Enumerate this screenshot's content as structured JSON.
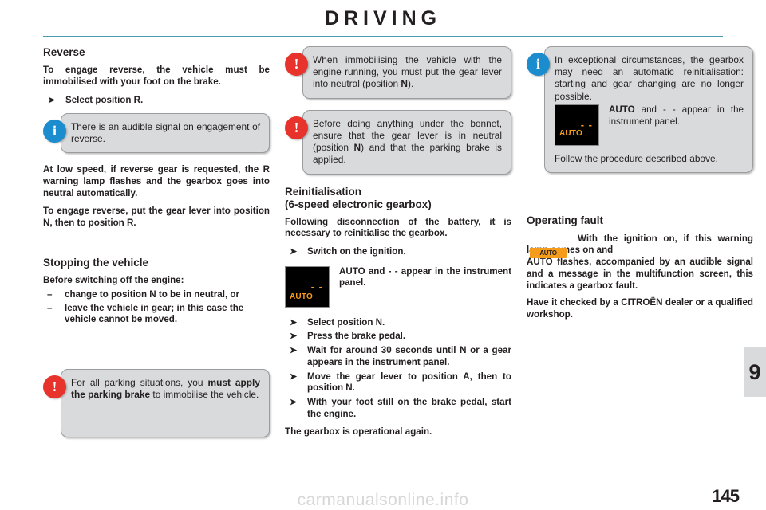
{
  "header": {
    "title": "DRIVING",
    "rule_color": "#4a9cb5"
  },
  "chapter_tab": {
    "number": "9",
    "background": "#d9dadb"
  },
  "page_number": "145",
  "watermark": "carmanualsonline.info",
  "colors": {
    "warning_red": "#e8322c",
    "info_blue": "#1b8ccd",
    "bubble_grey": "#d9dadb",
    "amber": "#f59c1a",
    "text": "#231f20"
  },
  "left_column": {
    "heading": "Reverse",
    "intro": "To engage reverse, the vehicle must be immobilised with your foot on the brake.",
    "bullets": [
      "Select position R."
    ],
    "info_callout": {
      "badge": "info-icon",
      "badge_glyph": "i",
      "text": "There is an audible signal on engagement of reverse."
    },
    "para_low_speed": "At low speed, if reverse gear is requested, the R warning lamp flashes and the gearbox goes into neutral automatically.",
    "para_engage": "To engage reverse, put the gear lever into position N, then to position R.",
    "stopping": {
      "heading": "Stopping the vehicle",
      "lead": "Before switching off the engine:",
      "items": [
        "change to position N to be in neutral, or",
        "leave the vehicle in gear; in this case the vehicle cannot be moved."
      ]
    },
    "parking_callout": {
      "badge": "warning-icon",
      "badge_glyph": "!",
      "text_before": "For all parking situations, you ",
      "text_bold": "must apply the parking brake",
      "text_after": " to immobilise the vehicle."
    }
  },
  "middle_column": {
    "callout_immobilising": {
      "badge": "warning-icon",
      "badge_glyph": "!",
      "text_1": "When immobilising the vehicle with the engine running, you must put the gear lever into neutral (position ",
      "text_bold": "N",
      "text_2": ")."
    },
    "callout_bonnet": {
      "badge": "warning-icon",
      "badge_glyph": "!",
      "text_1": "Before doing anything under the bonnet, ensure that the gear lever is in neutral (position ",
      "text_bold": "N",
      "text_2": ") and that the parking brake is applied."
    },
    "heading_line1": "Reinitialisation",
    "heading_line2": "(6-speed electronic gearbox)",
    "intro": "Following disconnection of the battery, it is necessary to reinitialise the gearbox.",
    "bullets_first": [
      "Switch on the ignition."
    ],
    "display": {
      "auto_label": "AUTO",
      "dashes_label": "- -",
      "caption_bold": "AUTO",
      "caption_rest": " and - - appear in the instrument panel."
    },
    "bullets_rest": [
      "Select position N.",
      "Press the brake pedal.",
      "Wait for around 30 seconds until N or a gear appears in the instrument panel.",
      "Move the gear lever to position A, then to position N.",
      "With your foot still on the brake pedal, start the engine."
    ],
    "closing": "The gearbox is operational again."
  },
  "right_column": {
    "callout_exceptional": {
      "badge": "info-icon",
      "badge_glyph": "i",
      "text": "In exceptional circumstances, the gearbox may need an automatic reinitialisation: starting and gear changing are no longer possible.",
      "display": {
        "auto_label": "AUTO",
        "dashes_label": "- -",
        "caption_bold": "AUTO",
        "caption_rest": " and - - appear in the instrument panel."
      },
      "follow_text": "Follow the procedure described above."
    },
    "fault": {
      "heading": "Operating fault",
      "lamp_label": "gearbox-fault-lamp",
      "lamp_text": "AUTO",
      "text_1": "With the ignition on, if this warning lamp comes on and ",
      "text_bold": "AUTO",
      "text_2": " flashes, accompanied by an audible signal and a message in the multifunction screen, this indicates a gearbox fault.",
      "text_3": "Have it checked by a CITROËN dealer or a qualified workshop."
    }
  }
}
